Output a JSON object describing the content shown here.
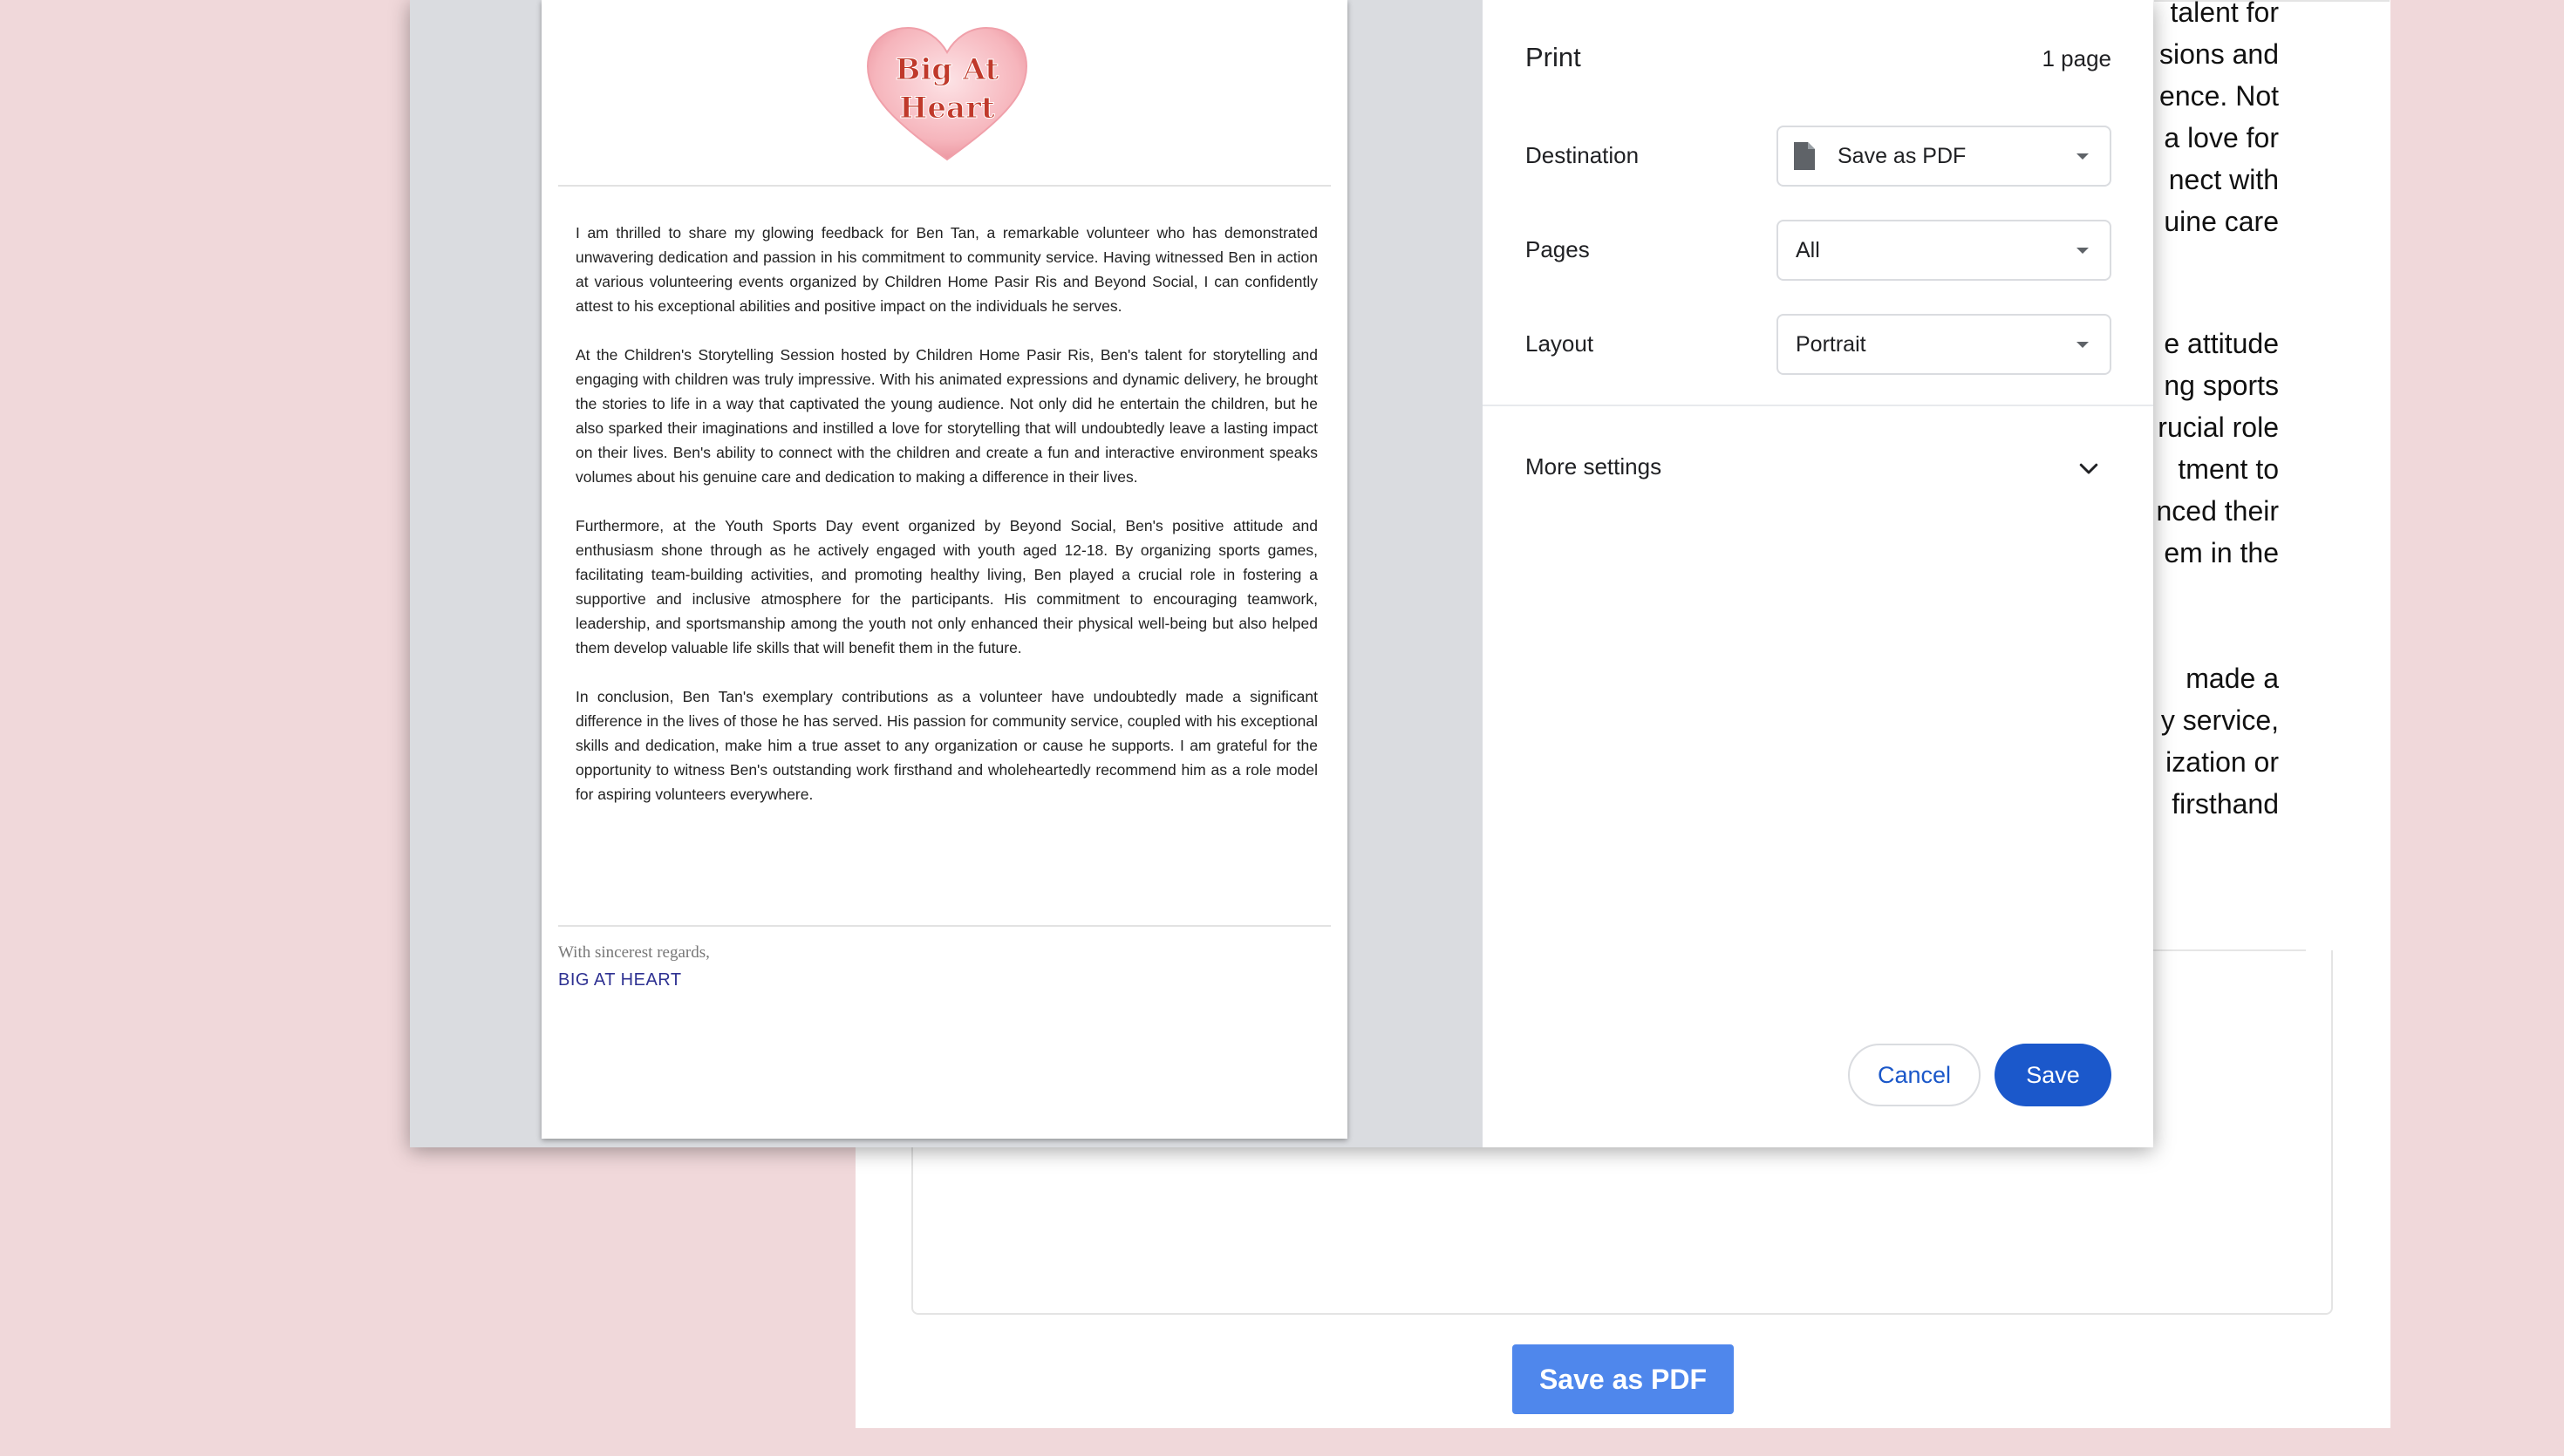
{
  "background_page": {
    "text_fragments": [
      "talent for",
      "sions and",
      "ence. Not",
      "a love for",
      "nect with",
      "uine care",
      "",
      "e attitude",
      "ng sports",
      "rucial role",
      "tment to",
      "nced their",
      "em in the",
      "",
      "made a",
      "y service,",
      "ization or",
      "firsthand"
    ],
    "save_pdf_button": "Save as PDF",
    "button_color": "#4f87ec"
  },
  "print_dialog": {
    "preview": {
      "logo_line1": "Big At",
      "logo_line2": "Heart",
      "paragraphs": [
        "I am thrilled to share my glowing feedback for Ben Tan, a remarkable volunteer who has demonstrated unwavering dedication and passion in his commitment to community service. Having witnessed Ben in action at various volunteering events organized by Children Home Pasir Ris and Beyond Social, I can confidently attest to his exceptional abilities and positive impact on the individuals he serves.",
        "At the Children's Storytelling Session hosted by Children Home Pasir Ris, Ben's talent for storytelling and engaging with children was truly impressive. With his animated expressions and dynamic delivery, he brought the stories to life in a way that captivated the young audience. Not only did he entertain the children, but he also sparked their imaginations and instilled a love for storytelling that will undoubtedly leave a lasting impact on their lives. Ben's ability to connect with the children and create a fun and interactive environment speaks volumes about his genuine care and dedication to making a difference in their lives.",
        "Furthermore, at the Youth Sports Day event organized by Beyond Social, Ben's positive attitude and enthusiasm shone through as he actively engaged with youth aged 12-18. By organizing sports games, facilitating team-building activities, and promoting healthy living, Ben played a crucial role in fostering a supportive and inclusive atmosphere for the participants. His commitment to encouraging teamwork, leadership, and sportsmanship among the youth not only enhanced their physical well-being but also helped them develop valuable life skills that will benefit them in the future.",
        "In conclusion, Ben Tan's exemplary contributions as a volunteer have undoubtedly made a significant difference in the lives of those he has served. His passion for community service, coupled with his exceptional skills and dedication, make him a true asset to any organization or cause he supports. I am grateful for the opportunity to witness Ben's outstanding work firsthand and wholeheartedly recommend him as a role model for aspiring volunteers everywhere."
      ],
      "sign_off": "With sincerest regards,",
      "organization": "BIG AT HEART"
    },
    "settings": {
      "title": "Print",
      "page_count": "1 page",
      "destination_label": "Destination",
      "destination_value": "Save as PDF",
      "destination_icon": "document-icon",
      "pages_label": "Pages",
      "pages_value": "All",
      "layout_label": "Layout",
      "layout_value": "Portrait",
      "more_settings": "More settings",
      "cancel": "Cancel",
      "save": "Save",
      "accent_color": "#1b58cb"
    }
  }
}
